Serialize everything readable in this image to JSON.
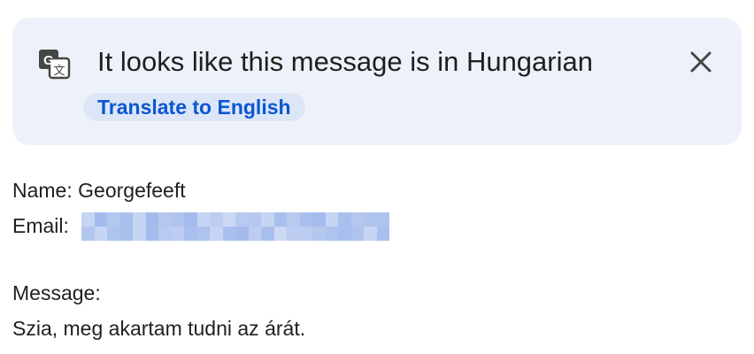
{
  "banner": {
    "title": "It looks like this message is in Hungarian",
    "action_label": "Translate to English"
  },
  "icons": {
    "translate": "google-translate-icon",
    "close": "close-icon"
  },
  "message": {
    "name_label": "Name:",
    "name_value": "Georgefeeft",
    "email_label": "Email:",
    "email_value_redacted": true,
    "message_label": "Message:",
    "message_body": "Szia, meg akartam tudni az árát."
  },
  "colors": {
    "banner_bg": "#edf2fa",
    "chip_bg": "#dde6f7",
    "link_blue": "#0b57d0",
    "text": "#1f1f1f",
    "redaction_blue": "#b3c7ef"
  }
}
